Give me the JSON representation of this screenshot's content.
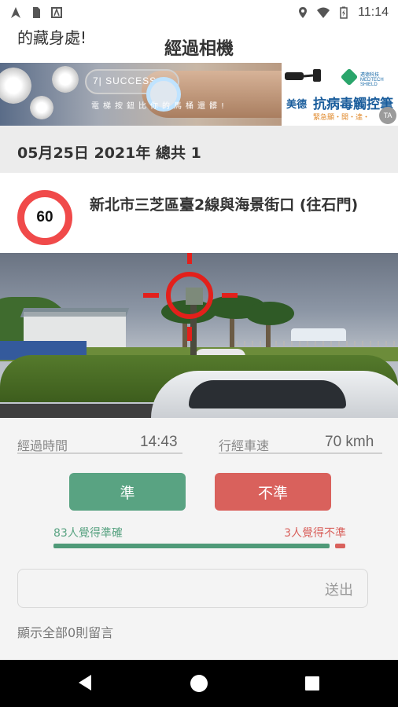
{
  "status_bar": {
    "time": "11:14",
    "left_icons": [
      "navigation-icon",
      "sim-card-icon",
      "app-notification-icon"
    ],
    "right_icons": [
      "location-icon",
      "wifi-icon",
      "battery-icon"
    ]
  },
  "header": {
    "back_text": "的藏身處!",
    "title": "經過相機"
  },
  "ad_banner": {
    "left_logo_text": "7| SUCCESS",
    "left_caption": "電梯按鈕比你的馬桶還髒!",
    "right_brand": "邁德科技 MEDTECH SHIELD",
    "right_title_prefix": "美德",
    "right_title": "抗病毒觸控筆",
    "right_subtitle": "緊急顯・開・達・",
    "ad_badge": "TA"
  },
  "date_summary": "05月25日 2021年 總共 1",
  "camera": {
    "speed_limit": "60",
    "location": "新北市三芝區臺2線與海景街口 (往石門)"
  },
  "stats": {
    "time_label": "經過時間",
    "time_value": "14:43",
    "speed_label": "行經車速",
    "speed_value": "70 kmh"
  },
  "vote": {
    "accurate_label": "準",
    "inaccurate_label": "不準",
    "accurate_text": "83人覺得準確",
    "inaccurate_text": "3人覺得不準",
    "accurate_count": 83,
    "inaccurate_count": 3
  },
  "comment": {
    "placeholder": "",
    "send_label": "送出",
    "show_all": "顯示全部0則留言"
  },
  "colors": {
    "accurate": "#59a382",
    "inaccurate": "#d9615c",
    "speed_sign_ring": "#f04a4a"
  }
}
